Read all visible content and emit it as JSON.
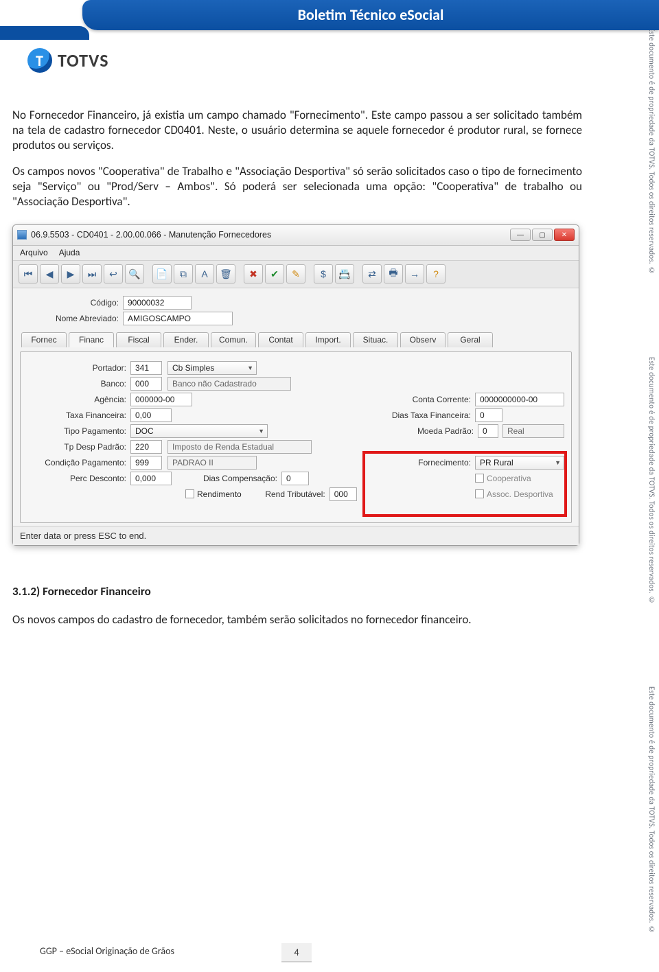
{
  "side_note": "Este documento é de propriedade da TOTVS. Todos os direitos reservados. ©",
  "header_title": "Boletim Técnico eSocial",
  "brand": "TOTVS",
  "paragraph_1": "No Fornecedor Financeiro, já existia um campo chamado \"Fornecimento\". Este campo passou a ser solicitado também na tela de cadastro fornecedor CD0401. Neste, o usuário determina se aquele fornecedor é produtor rural, se fornece produtos ou serviços.",
  "paragraph_2": "Os campos novos \"Cooperativa\" de Trabalho e \"Associação Desportiva\" só serão solicitados caso o tipo de fornecimento seja \"Serviço\" ou \"Prod/Serv – Ambos\". Só poderá ser selecionada uma opção: \"Cooperativa\" de trabalho ou \"Associação Desportiva\".",
  "window": {
    "title": "06.9.5503 - CD0401 - 2.00.00.066 - Manutenção Fornecedores",
    "menu": {
      "arquivo": "Arquivo",
      "ajuda": "Ajuda"
    },
    "header_fields": {
      "codigo_label": "Código:",
      "codigo_value": "90000032",
      "nome_label": "Nome Abreviado:",
      "nome_value": "AMIGOSCAMPO"
    },
    "tabs": [
      "Fornec",
      "Financ",
      "Fiscal",
      "Ender.",
      "Comun.",
      "Contat",
      "Import.",
      "Situac.",
      "Observ",
      "Geral"
    ],
    "active_tab_index": 1,
    "financ": {
      "portador_label": "Portador:",
      "portador_value": "341",
      "portador_combo": "Cb Simples",
      "banco_label": "Banco:",
      "banco_value": "000",
      "banco_desc": "Banco não Cadastrado",
      "agencia_label": "Agência:",
      "agencia_value": "000000-00",
      "conta_label": "Conta Corrente:",
      "conta_value": "0000000000-00",
      "taxa_label": "Taxa Financeira:",
      "taxa_value": "0,00",
      "dias_taxa_label": "Dias Taxa Financeira:",
      "dias_taxa_value": "0",
      "tipo_pag_label": "Tipo Pagamento:",
      "tipo_pag_value": "DOC",
      "moeda_label": "Moeda Padrão:",
      "moeda_code": "0",
      "moeda_desc": "Real",
      "tp_desp_label": "Tp Desp Padrão:",
      "tp_desp_value": "220",
      "tp_desp_desc": "Imposto de Renda Estadual",
      "cond_pag_label": "Condição Pagamento:",
      "cond_pag_value": "999",
      "cond_pag_desc": "PADRAO II",
      "fornecimento_label": "Fornecimento:",
      "fornecimento_value": "PR Rural",
      "perc_desc_label": "Perc Desconto:",
      "perc_desc_value": "0,000",
      "dias_comp_label": "Dias Compensação:",
      "dias_comp_value": "0",
      "cooperativa_label": "Cooperativa",
      "rendimento_label": "Rendimento",
      "rend_trib_label": "Rend Tributável:",
      "rend_trib_value": "000",
      "assoc_label": "Assoc. Desportiva"
    },
    "status": "Enter data or press ESC to end."
  },
  "section_heading": "3.1.2) Fornecedor Financeiro",
  "paragraph_3": "Os novos campos do cadastro de fornecedor, também serão solicitados no fornecedor financeiro.",
  "footer": "GGP – eSocial Originação de Grãos",
  "page_number": "4"
}
